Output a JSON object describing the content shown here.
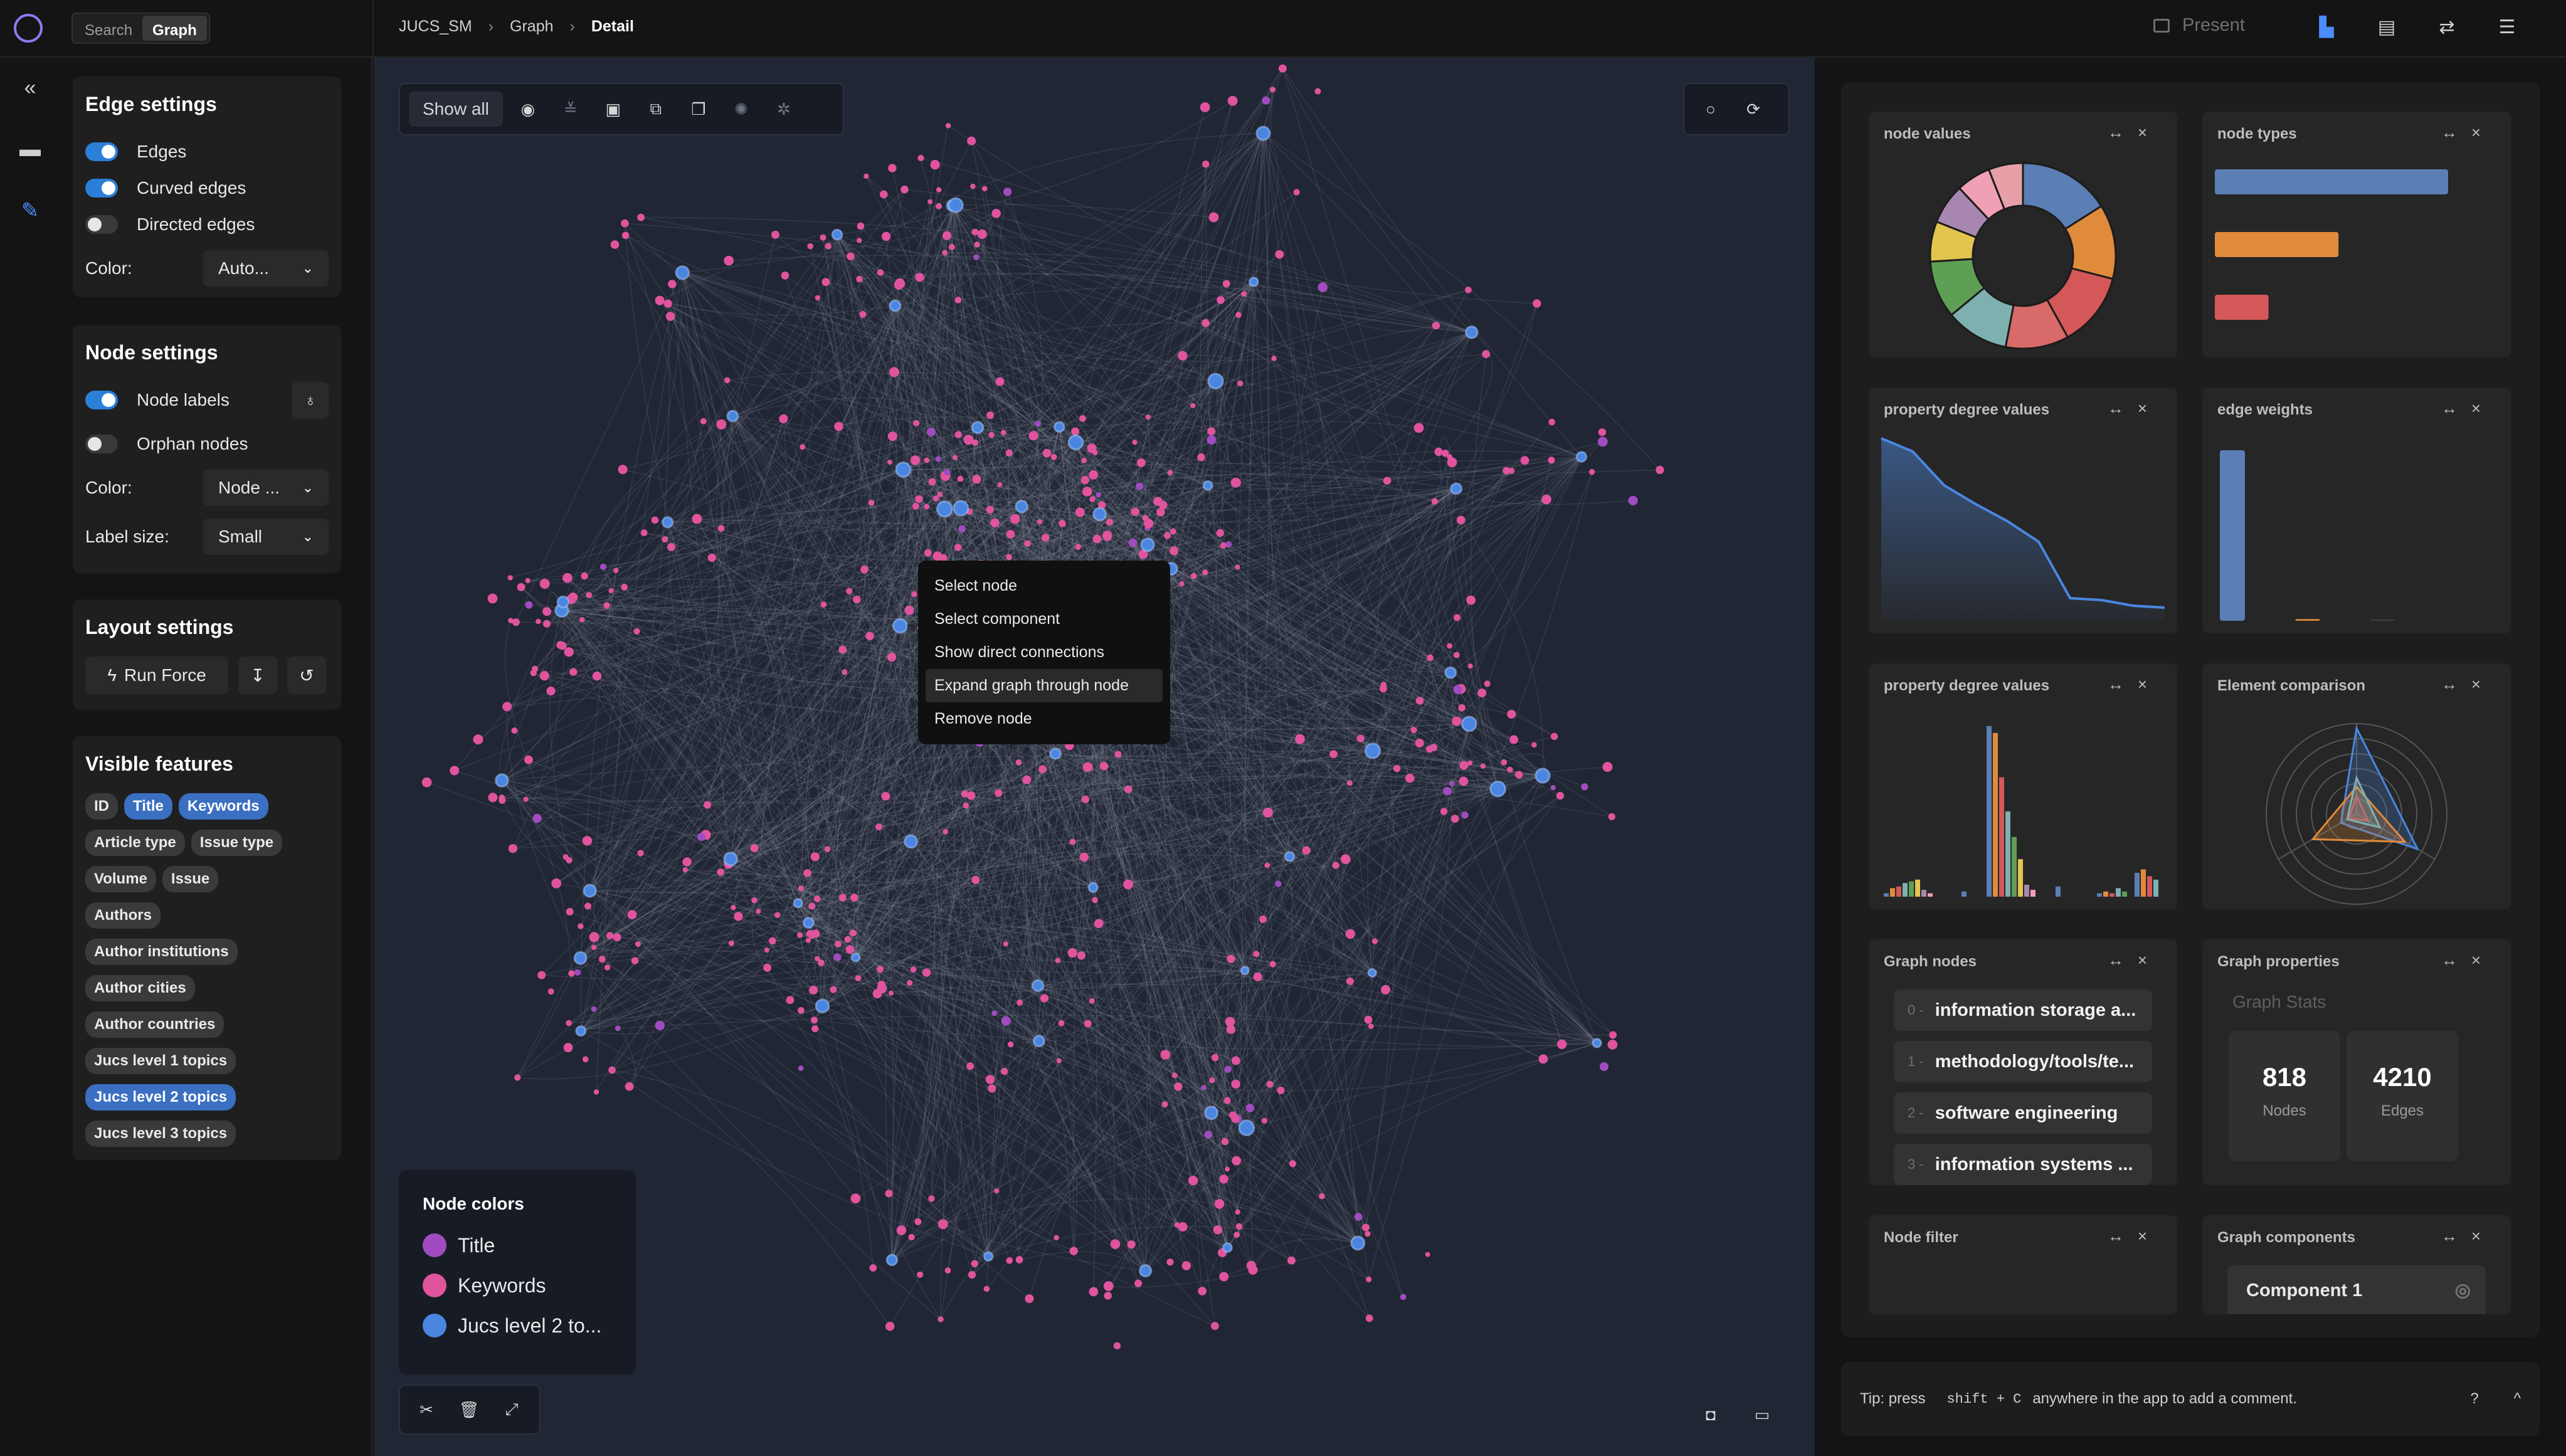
{
  "topbar": {
    "mode_tabs": [
      "Search",
      "Graph"
    ],
    "breadcrumb": [
      "JUCS_SM",
      "Graph",
      "Detail"
    ],
    "present_label": "Present"
  },
  "sidebar": {
    "edge_settings": {
      "title": "Edge settings",
      "edges_label": "Edges",
      "edges_on": true,
      "curved_label": "Curved edges",
      "curved_on": true,
      "directed_label": "Directed edges",
      "directed_on": false,
      "color_label": "Color:",
      "color_value": "Auto..."
    },
    "node_settings": {
      "title": "Node settings",
      "labels_label": "Node labels",
      "labels_on": true,
      "orphan_label": "Orphan nodes",
      "orphan_on": false,
      "color_label": "Color:",
      "color_value": "Node ...",
      "label_size_label": "Label size:",
      "label_size_value": "Small"
    },
    "layout_settings": {
      "title": "Layout settings",
      "run_force_label": "Run Force"
    },
    "visible_features": {
      "title": "Visible features",
      "chips": [
        {
          "label": "ID",
          "active": false
        },
        {
          "label": "Title",
          "active": true
        },
        {
          "label": "Keywords",
          "active": true
        },
        {
          "label": "Article type",
          "active": false
        },
        {
          "label": "Issue type",
          "active": false
        },
        {
          "label": "Volume",
          "active": false
        },
        {
          "label": "Issue",
          "active": false
        },
        {
          "label": "Authors",
          "active": false
        },
        {
          "label": "Author institutions",
          "active": false
        },
        {
          "label": "Author cities",
          "active": false
        },
        {
          "label": "Author countries",
          "active": false
        },
        {
          "label": "Jucs level 1 topics",
          "active": false
        },
        {
          "label": "Jucs level 2 topics",
          "active": true
        },
        {
          "label": "Jucs level 3 topics",
          "active": false
        }
      ]
    }
  },
  "canvas": {
    "show_all_label": "Show all",
    "context_menu": [
      "Select node",
      "Select component",
      "Show direct connections",
      "Expand graph through node",
      "Remove node"
    ],
    "context_menu_highlighted": "Expand graph through node",
    "legend": {
      "title": "Node colors",
      "items": [
        {
          "label": "Title",
          "color": "#a04cc0"
        },
        {
          "label": "Keywords",
          "color": "#e0549e"
        },
        {
          "label": "Jucs level 2 to...",
          "color": "#4a86e0"
        }
      ]
    }
  },
  "widgets": {
    "node_values": {
      "title": "node values",
      "slices": [
        "#5b7fb5",
        "#e08a3c",
        "#d45858",
        "#d96a6a",
        "#7fb0b0",
        "#5e9e55",
        "#e2c44f",
        "#a787b0",
        "#f0a0b4",
        "#e8a0a8"
      ]
    },
    "node_types": {
      "title": "node types",
      "bars": [
        {
          "value": 1.0,
          "color": "#5b7fb5"
        },
        {
          "value": 0.53,
          "color": "#e08a3c"
        },
        {
          "value": 0.23,
          "color": "#d45858"
        }
      ]
    },
    "property_degree_1": {
      "title": "property degree values",
      "series": [
        0.97,
        0.9,
        0.72,
        0.62,
        0.53,
        0.42,
        0.12,
        0.11,
        0.08,
        0.07
      ]
    },
    "edge_weights": {
      "title": "edge weights",
      "bars": [
        {
          "value": 1.0,
          "color": "#5b7fb5"
        },
        {
          "value": 0.01,
          "color": "#e08a3c"
        },
        {
          "value": 0.005,
          "color": "#444"
        }
      ]
    },
    "property_degree_2": {
      "title": "property degree values"
    },
    "element_comparison": {
      "title": "Element comparison"
    },
    "graph_nodes": {
      "title": "Graph nodes",
      "items": [
        {
          "index": "0 -",
          "label": "information storage a..."
        },
        {
          "index": "1 -",
          "label": "methodology/tools/te..."
        },
        {
          "index": "2 -",
          "label": "software engineering"
        },
        {
          "index": "3 -",
          "label": "information systems ..."
        }
      ]
    },
    "graph_properties": {
      "title": "Graph properties",
      "subtitle": "Graph Stats",
      "nodes_value": "818",
      "nodes_label": "Nodes",
      "edges_value": "4210",
      "edges_label": "Edges"
    },
    "node_filter": {
      "title": "Node filter"
    },
    "graph_components": {
      "title": "Graph components",
      "component_label": "Component 1"
    }
  },
  "tipbar": {
    "prefix": "Tip: press",
    "keys": "shift + C",
    "suffix": "anywhere in the app to add a comment.",
    "help": "?",
    "collapse": "^"
  }
}
